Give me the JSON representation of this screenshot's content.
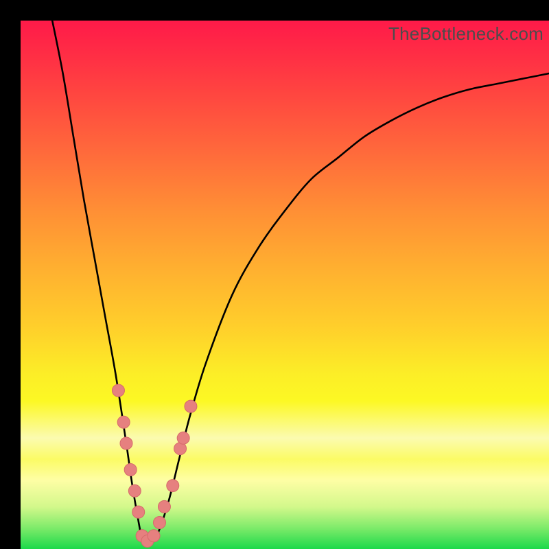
{
  "watermark": "TheBottleneck.com",
  "colors": {
    "curve_stroke": "#000000",
    "marker_fill": "#e6807f",
    "marker_stroke": "#d56b6a"
  },
  "chart_data": {
    "type": "line",
    "title": "",
    "xlabel": "",
    "ylabel": "",
    "xlim": [
      0,
      100
    ],
    "ylim": [
      0,
      100
    ],
    "note": "Axes unlabeled in source image. V-shaped bottleneck curve with minimum near x≈23; y values estimated as percent of plot height from bottom.",
    "series": [
      {
        "name": "bottleneck-curve",
        "x": [
          6,
          8,
          10,
          12,
          14,
          16,
          18,
          20,
          21,
          22,
          23,
          24,
          25,
          26,
          28,
          30,
          32,
          35,
          40,
          45,
          50,
          55,
          60,
          65,
          70,
          75,
          80,
          85,
          90,
          95,
          100
        ],
        "y": [
          100,
          90,
          78,
          66,
          55,
          44,
          33,
          20,
          13,
          7,
          2,
          1.5,
          1.5,
          3,
          9,
          17,
          25,
          35,
          48,
          57,
          64,
          70,
          74,
          78,
          81,
          83.5,
          85.5,
          87,
          88,
          89,
          90
        ]
      }
    ],
    "markers": {
      "name": "highlighted-points",
      "x": [
        18.5,
        19.5,
        20.0,
        20.8,
        21.6,
        22.3,
        23.0,
        24.0,
        25.2,
        26.3,
        27.2,
        28.8,
        30.2,
        30.8,
        32.2
      ],
      "y": [
        30,
        24,
        20,
        15,
        11,
        7,
        2.5,
        1.5,
        2.5,
        5,
        8,
        12,
        19,
        21,
        27
      ]
    }
  }
}
